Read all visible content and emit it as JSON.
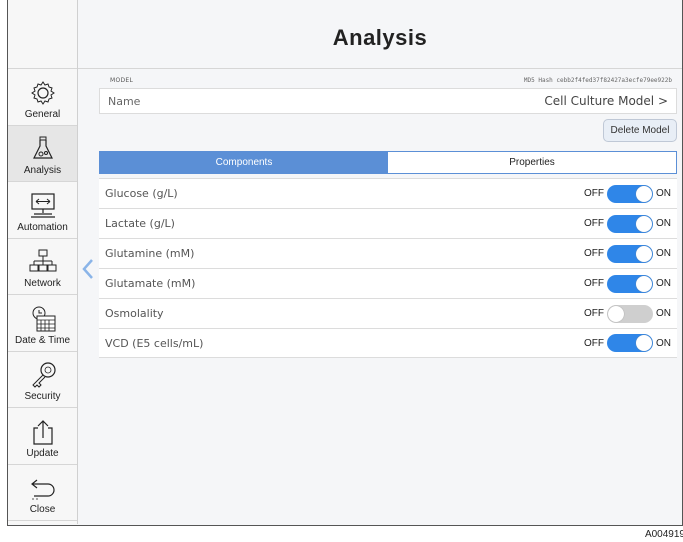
{
  "page": {
    "title": "Analysis"
  },
  "sidebar": {
    "items": [
      {
        "label": "General",
        "icon": "gear-icon",
        "active": false
      },
      {
        "label": "Analysis",
        "icon": "flask-icon",
        "active": true
      },
      {
        "label": "Automation",
        "icon": "monitor-arrows-icon",
        "active": false
      },
      {
        "label": "Network",
        "icon": "network-icon",
        "active": false
      },
      {
        "label": "Date & Time",
        "icon": "calendar-clock-icon",
        "active": false
      },
      {
        "label": "Security",
        "icon": "key-icon",
        "active": false
      },
      {
        "label": "Update",
        "icon": "upload-icon",
        "active": false
      },
      {
        "label": "Close",
        "icon": "back-arrow-icon",
        "active": false
      }
    ]
  },
  "model": {
    "section_label": "MODEL",
    "md5": "MD5 Hash cebb2f4fed37f82427a3ecfe79ee922b",
    "name_key": "Name",
    "name_value": "Cell Culture Model >",
    "delete_label": "Delete Model"
  },
  "tabs": [
    {
      "label": "Components",
      "selected": true
    },
    {
      "label": "Properties",
      "selected": false
    }
  ],
  "components": [
    {
      "name": "Glucose (g/L)",
      "off": "OFF",
      "on": "ON",
      "enabled": true
    },
    {
      "name": "Lactate (g/L)",
      "off": "OFF",
      "on": "ON",
      "enabled": true
    },
    {
      "name": "Glutamine (mM)",
      "off": "OFF",
      "on": "ON",
      "enabled": true
    },
    {
      "name": "Glutamate (mM)",
      "off": "OFF",
      "on": "ON",
      "enabled": true
    },
    {
      "name": "Osmolality",
      "off": "OFF",
      "on": "ON",
      "enabled": false
    },
    {
      "name": "VCD (E5 cells/mL)",
      "off": "OFF",
      "on": "ON",
      "enabled": true
    }
  ],
  "figure_code": "A004919",
  "colors": {
    "accent": "#5b8fd6",
    "switch_on": "#2f86e8",
    "switch_off": "#cfcfcf"
  }
}
